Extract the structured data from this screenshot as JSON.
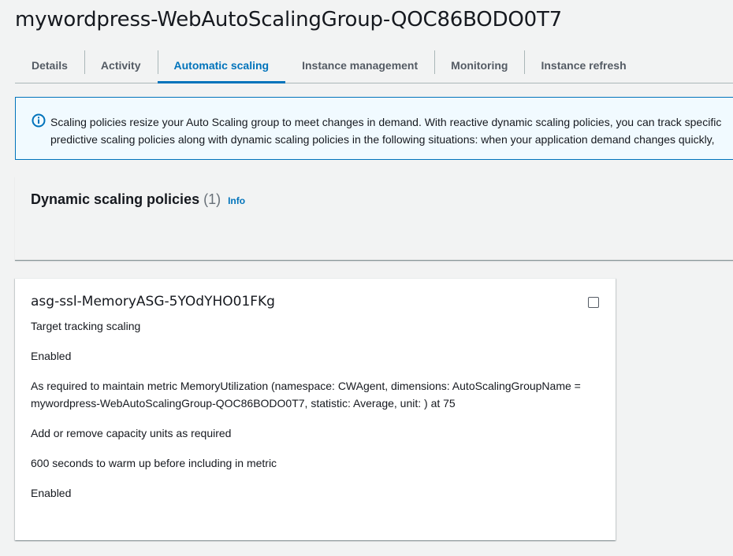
{
  "page": {
    "title": "mywordpress-WebAutoScalingGroup-QOC86BODO0T7"
  },
  "tabs": [
    {
      "label": "Details",
      "active": false
    },
    {
      "label": "Activity",
      "active": false
    },
    {
      "label": "Automatic scaling",
      "active": true
    },
    {
      "label": "Instance management",
      "active": false
    },
    {
      "label": "Monitoring",
      "active": false
    },
    {
      "label": "Instance refresh",
      "active": false
    }
  ],
  "info_alert": {
    "icon": "info-circle-icon",
    "line1": "Scaling policies resize your Auto Scaling group to meet changes in demand. With reactive dynamic scaling policies, you can track specific",
    "line2": "predictive scaling policies along with dynamic scaling policies in the following situations: when your application demand changes quickly,"
  },
  "dynamic_scaling": {
    "title": "Dynamic scaling policies",
    "count": "(1)",
    "info_link": "Info"
  },
  "policy": {
    "name": "asg-ssl-MemoryASG-5YOdYHO01FKg",
    "type": "Target tracking scaling",
    "status": "Enabled",
    "description_line1": "As required to maintain metric MemoryUtilization (namespace: CWAgent, dimensions: AutoScalingGroupName =",
    "description_line2": "mywordpress-WebAutoScalingGroup-QOC86BODO0T7, statistic: Average, unit: ) at 75",
    "capacity": "Add or remove capacity units as required",
    "warmup": "600 seconds to warm up before including in metric",
    "scale_in": "Enabled",
    "selected": false
  },
  "colors": {
    "accent": "#0073bb",
    "text": "#16191f",
    "muted": "#545b64",
    "background": "#f2f3f3",
    "alert_bg": "#f1faff"
  }
}
